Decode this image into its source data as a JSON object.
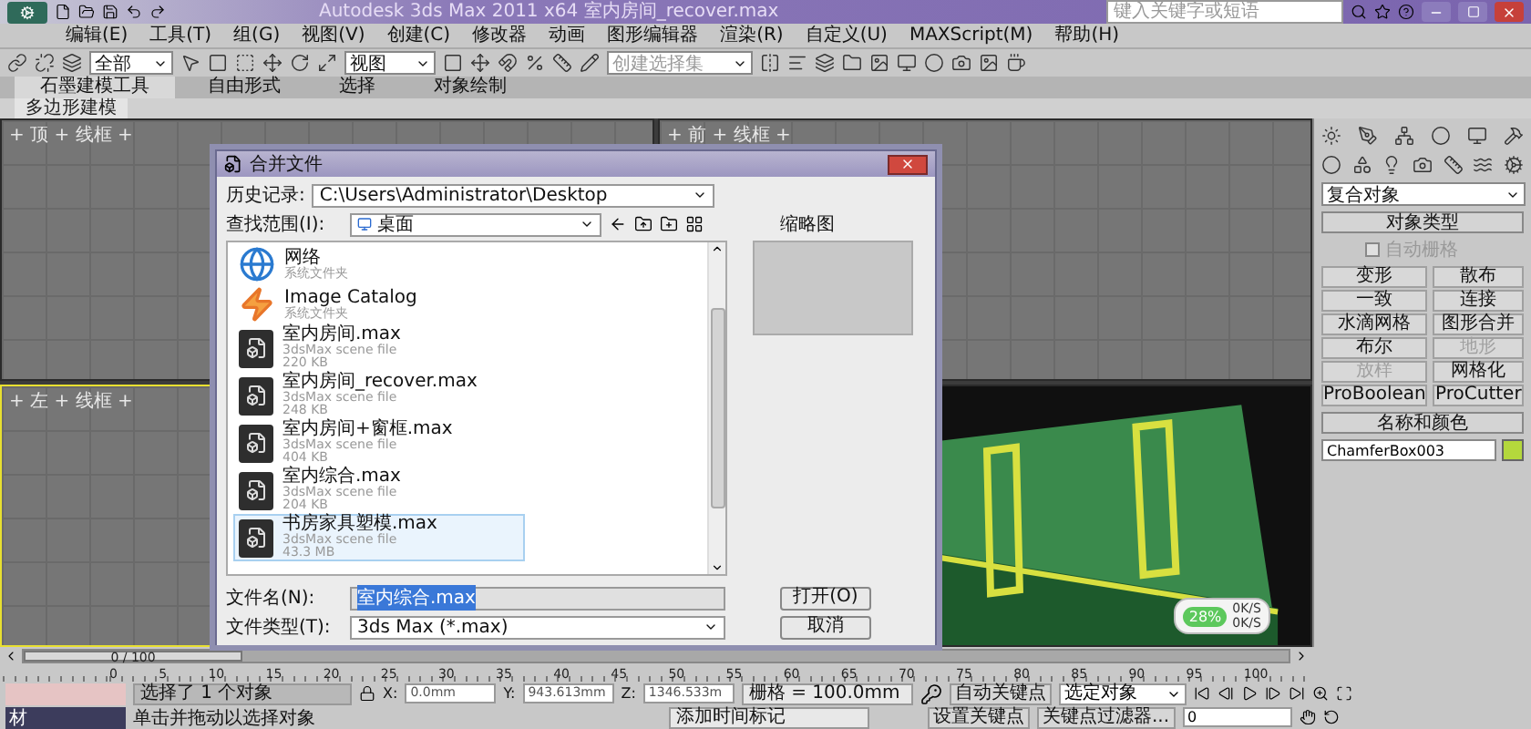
{
  "title_bar": {
    "title": "Autodesk 3ds Max 2011 x64",
    "file": "室内房间_recover.max",
    "search_placeholder": "键入关键字或短语"
  },
  "menu": [
    "编辑(E)",
    "工具(T)",
    "组(G)",
    "视图(V)",
    "创建(C)",
    "修改器",
    "动画",
    "图形编辑器",
    "渲染(R)",
    "自定义(U)",
    "MAXScript(M)",
    "帮助(H)"
  ],
  "toolbar": {
    "filter": "全部",
    "coord": "视图",
    "selection_set_placeholder": "创建选择集"
  },
  "ribbon": {
    "tabs": [
      {
        "label": "石墨建模工具",
        "selected": true
      },
      {
        "label": "自由形式",
        "selected": false
      },
      {
        "label": "选择",
        "selected": false
      },
      {
        "label": "对象绘制",
        "selected": false
      }
    ],
    "panel": "多边形建模"
  },
  "viewports": [
    {
      "label": "+ 顶 + 线框 +",
      "kind": "wire",
      "active": false
    },
    {
      "label": "+ 前 + 线框 +",
      "kind": "wire",
      "active": false
    },
    {
      "label": "+ 左 + 线框 +",
      "kind": "wire",
      "active": true
    },
    {
      "kind": "scene",
      "active": false
    }
  ],
  "net_meter": {
    "percent": "28%",
    "up": "0K/S",
    "down": "0K/S"
  },
  "dialog": {
    "title": "合并文件",
    "history_label": "历史记录:",
    "history": "C:\\Users\\Administrator\\Desktop",
    "lookin_label": "查找范围(I):",
    "lookin": "桌面",
    "thumbnail_label": "缩略图",
    "items": [
      {
        "name": "网络",
        "type": "系统文件夹",
        "kind": "network",
        "selected": false
      },
      {
        "name": "Image Catalog",
        "type": "系统文件夹",
        "kind": "catalog",
        "selected": false
      },
      {
        "name": "室内房间.max",
        "type": "3dsMax scene file",
        "size": "220 KB",
        "kind": "max",
        "selected": false
      },
      {
        "name": "室内房间_recover.max",
        "type": "3dsMax scene file",
        "size": "248 KB",
        "kind": "max",
        "selected": false
      },
      {
        "name": "室内房间+窗框.max",
        "type": "3dsMax scene file",
        "size": "404 KB",
        "kind": "max",
        "selected": false
      },
      {
        "name": "室内综合.max",
        "type": "3dsMax scene file",
        "size": "204 KB",
        "kind": "max",
        "selected": false
      },
      {
        "name": "书房家具塑模.max",
        "type": "3dsMax scene file",
        "size": "43.3 MB",
        "kind": "max",
        "selected": true
      }
    ],
    "filename_label": "文件名(N):",
    "filename": "室内综合.max",
    "filetype_label": "文件类型(T):",
    "filetype": "3ds Max (*.max)",
    "buttons": [
      "打开(O)",
      "取消"
    ]
  },
  "command_panel": {
    "category": "复合对象",
    "object_type_title": "对象类型",
    "autogrid": {
      "label": "自动栅格",
      "checked": false,
      "disabled": true
    },
    "buttons": [
      {
        "label": "变形",
        "disabled": false
      },
      {
        "label": "散布",
        "disabled": false
      },
      {
        "label": "一致",
        "disabled": false
      },
      {
        "label": "连接",
        "disabled": false
      },
      {
        "label": "水滴网格",
        "disabled": false
      },
      {
        "label": "图形合并",
        "disabled": false
      },
      {
        "label": "布尔",
        "disabled": false
      },
      {
        "label": "地形",
        "disabled": true
      },
      {
        "label": "放样",
        "disabled": true
      },
      {
        "label": "网格化",
        "disabled": false
      },
      {
        "label": "ProBoolean",
        "disabled": false
      },
      {
        "label": "ProCutter",
        "disabled": false
      }
    ],
    "name_color_title": "名称和颜色",
    "name": "ChamferBox003",
    "color": "#b4d83c"
  },
  "timeline": {
    "position": "0 / 100",
    "level": 0,
    "ruler": [
      "0",
      "5",
      "10",
      "15",
      "20",
      "25",
      "30",
      "35",
      "40",
      "45",
      "50",
      "55",
      "60",
      "65",
      "70",
      "75",
      "80",
      "85",
      "90",
      "95",
      "100"
    ]
  },
  "status": {
    "selected": "选择了 1 个对象",
    "prompt": "单击并拖动以选择对象",
    "x_label": "X:",
    "x": "0.0mm",
    "y_label": "Y:",
    "y": "943.613mm",
    "z_label": "Z:",
    "z": "1346.533m",
    "grid": "栅格 = 100.0mm",
    "add_marker": "添加时间标记",
    "auto_key": "自动关键点",
    "set_key": "设置关键点",
    "key_mode": "选定对象",
    "key_filter": "关键点过滤器...",
    "frame": "0",
    "minimized_window": "材"
  }
}
